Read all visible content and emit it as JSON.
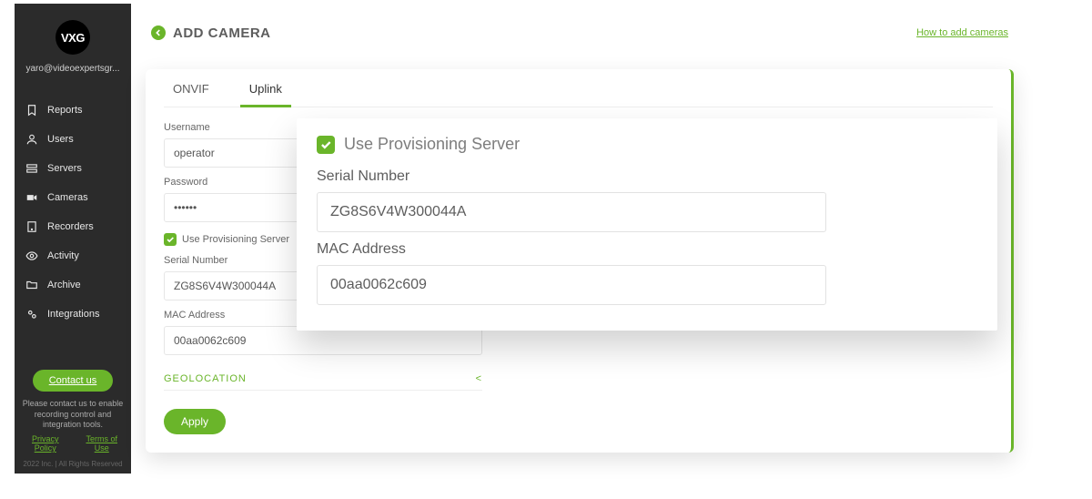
{
  "brand": "VXG",
  "user_email": "yaro@videoexpertsgr...",
  "nav": {
    "items": [
      {
        "key": "reports",
        "label": "Reports"
      },
      {
        "key": "users",
        "label": "Users"
      },
      {
        "key": "servers",
        "label": "Servers"
      },
      {
        "key": "cameras",
        "label": "Cameras"
      },
      {
        "key": "recorders",
        "label": "Recorders"
      },
      {
        "key": "activity",
        "label": "Activity"
      },
      {
        "key": "archive",
        "label": "Archive"
      },
      {
        "key": "integrations",
        "label": "Integrations"
      }
    ]
  },
  "contact_button": "Contact us",
  "sidebar_message": "Please contact us to enable recording control and integration tools.",
  "sidebar_links": {
    "privacy": "Privacy Policy",
    "terms": "Terms of Use"
  },
  "sidebar_footer": "2022 Inc. | All Rights Reserved",
  "header": {
    "title": "ADD CAMERA",
    "help_link": "How to add cameras"
  },
  "tabs": {
    "onvif": "ONVIF",
    "uplink": "Uplink",
    "active": "uplink"
  },
  "form": {
    "username_label": "Username",
    "username_value": "operator",
    "password_label": "Password",
    "password_value": "••••••",
    "provisioning_label": "Use Provisioning Server",
    "serial_label": "Serial Number",
    "serial_value": "ZG8S6V4W300044A",
    "mac_label": "MAC Address",
    "mac_value": "00aa0062c609",
    "geolocation_label": "GEOLOCATION",
    "geolocation_toggle": "<",
    "apply_label": "Apply"
  },
  "overlay": {
    "provisioning_label": "Use Provisioning Server",
    "serial_label": "Serial Number",
    "serial_value": "ZG8S6V4W300044A",
    "mac_label": "MAC Address",
    "mac_value": "00aa0062c609"
  }
}
